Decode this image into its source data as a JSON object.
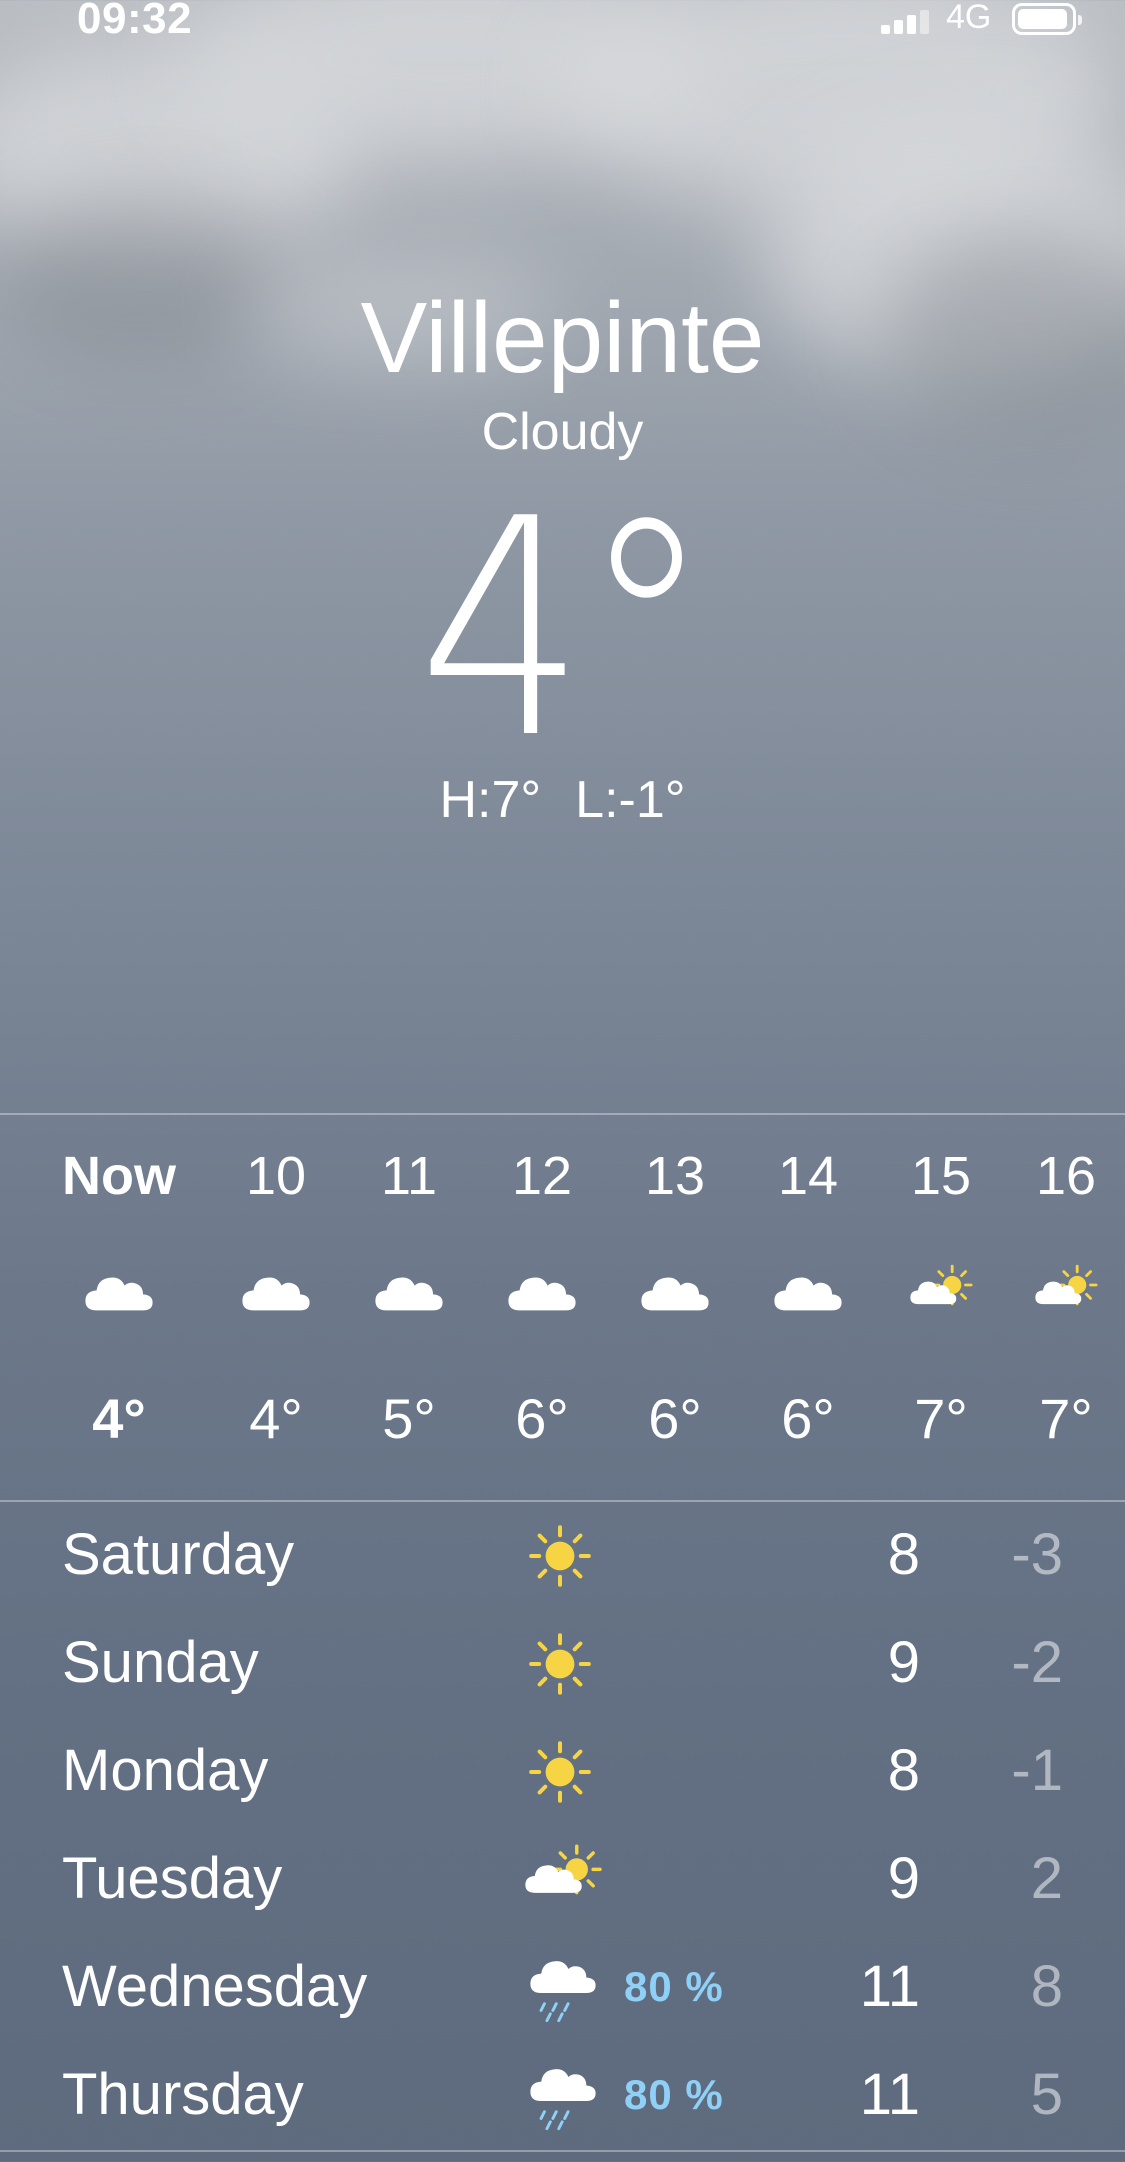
{
  "status_bar": {
    "time": "09:32",
    "network": "4G",
    "battery_level": 0.95
  },
  "current": {
    "city": "Villepinte",
    "condition": "Cloudy",
    "temperature": "4°",
    "high": "H:7°",
    "low": "L:-1°"
  },
  "hourly": [
    {
      "label": "Now",
      "icon": "cloud-icon",
      "temp": "4°"
    },
    {
      "label": "10",
      "icon": "cloud-icon",
      "temp": "4°"
    },
    {
      "label": "11",
      "icon": "cloud-icon",
      "temp": "5°"
    },
    {
      "label": "12",
      "icon": "cloud-icon",
      "temp": "6°"
    },
    {
      "label": "13",
      "icon": "cloud-icon",
      "temp": "6°"
    },
    {
      "label": "14",
      "icon": "cloud-icon",
      "temp": "6°"
    },
    {
      "label": "15",
      "icon": "partly-sunny-icon",
      "temp": "7°"
    },
    {
      "label": "16",
      "icon": "partly-sunny-icon",
      "temp": "7°"
    }
  ],
  "daily": [
    {
      "day": "Saturday",
      "icon": "sun-icon",
      "precip": "",
      "high": "8",
      "low": "-3"
    },
    {
      "day": "Sunday",
      "icon": "sun-icon",
      "precip": "",
      "high": "9",
      "low": "-2"
    },
    {
      "day": "Monday",
      "icon": "sun-icon",
      "precip": "",
      "high": "8",
      "low": "-1"
    },
    {
      "day": "Tuesday",
      "icon": "partly-sunny-icon",
      "precip": "",
      "high": "9",
      "low": "2"
    },
    {
      "day": "Wednesday",
      "icon": "rain-icon",
      "precip": "80 %",
      "high": "11",
      "low": "8"
    },
    {
      "day": "Thursday",
      "icon": "rain-icon",
      "precip": "80 %",
      "high": "11",
      "low": "5"
    }
  ],
  "colors": {
    "sun": "#f6d443",
    "precip": "#8fd0f7",
    "low_temp": "rgba(255,255,255,0.5)"
  }
}
